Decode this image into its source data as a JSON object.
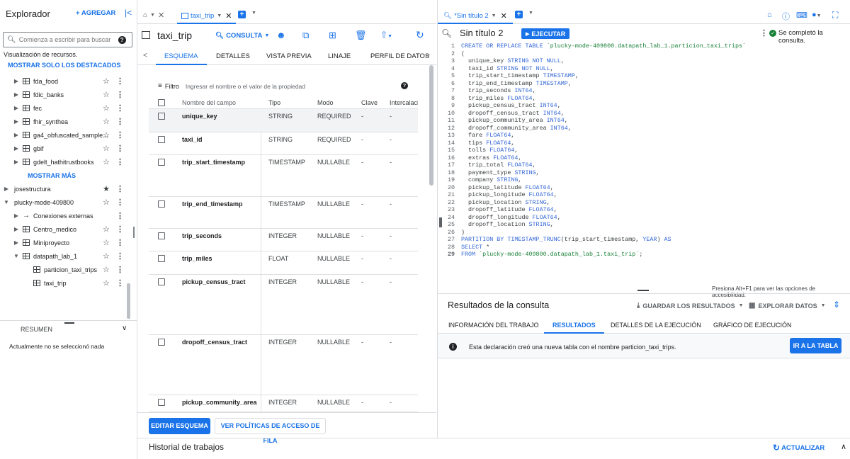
{
  "explorer": {
    "title": "Explorador",
    "add_label": "+ AGREGAR",
    "search_placeholder": "Comienza a escribir para buscar",
    "visualization": "Visualización de recursos.",
    "show_starred": "MOSTRAR SOLO LOS DESTACADOS",
    "show_more": "MOSTRAR MÁS",
    "items": [
      {
        "label": "fda_food"
      },
      {
        "label": "fdic_banks"
      },
      {
        "label": "fec"
      },
      {
        "label": "fhir_synthea"
      },
      {
        "label": "ga4_obfuscated_sample..."
      },
      {
        "label": "gbif"
      },
      {
        "label": "gdelt_hathitrustbooks"
      }
    ],
    "projects": [
      {
        "label": "josestructura"
      },
      {
        "label": "plucky-mode-409800"
      }
    ],
    "sub_items": [
      {
        "label": "Conexiones externas"
      },
      {
        "label": "Centro_medico"
      },
      {
        "label": "Miniproyecto"
      },
      {
        "label": "datapath_lab_1"
      }
    ],
    "tables": [
      {
        "label": "particion_taxi_trips"
      },
      {
        "label": "taxi_trip"
      }
    ],
    "summary_label": "RESUMEN",
    "summary_text": "Actualmente no se seleccionó nada"
  },
  "mid": {
    "tab_label": "taxi_trip",
    "title": "taxi_trip",
    "query_label": "CONSULTA",
    "tabs": [
      "ESQUEMA",
      "DETALLES",
      "VISTA PREVIA",
      "LINAJE",
      "PERFIL DE DATOS"
    ],
    "filter_label": "Filtro",
    "filter_placeholder": "Ingresar el nombre o el valor de la propiedad",
    "headers": [
      "Nombre del campo",
      "Tipo",
      "Modo",
      "Clave",
      "Intercalación"
    ],
    "rows": [
      {
        "name": "unique_key",
        "type": "STRING",
        "mode": "REQUIRED",
        "key": "-",
        "coll": "-"
      },
      {
        "name": "taxi_id",
        "type": "STRING",
        "mode": "REQUIRED",
        "key": "-",
        "coll": "-"
      },
      {
        "name": "trip_start_timestamp",
        "type": "TIMESTAMP",
        "mode": "NULLABLE",
        "key": "-",
        "coll": "-"
      },
      {
        "name": "trip_end_timestamp",
        "type": "TIMESTAMP",
        "mode": "NULLABLE",
        "key": "-",
        "coll": "-"
      },
      {
        "name": "trip_seconds",
        "type": "INTEGER",
        "mode": "NULLABLE",
        "key": "-",
        "coll": "-"
      },
      {
        "name": "trip_miles",
        "type": "FLOAT",
        "mode": "NULLABLE",
        "key": "-",
        "coll": "-"
      },
      {
        "name": "pickup_census_tract",
        "type": "INTEGER",
        "mode": "NULLABLE",
        "key": "-",
        "coll": "-"
      },
      {
        "name": "dropoff_census_tract",
        "type": "INTEGER",
        "mode": "NULLABLE",
        "key": "-",
        "coll": "-"
      },
      {
        "name": "pickup_community_area",
        "type": "INTEGER",
        "mode": "NULLABLE",
        "key": "-",
        "coll": "-"
      }
    ],
    "edit_schema": "EDITAR ESQUEMA",
    "row_policy": "VER POLÍTICAS DE ACCESO DE FILA",
    "history": "Historial de trabajos",
    "refresh": "ACTUALIZAR"
  },
  "right": {
    "tab_label": "*Sin título 2",
    "title": "Sin título 2",
    "run_label": "EJECUTAR",
    "status": "Se completó la consulta.",
    "code_lines": [
      [
        "kw:CREATE OR REPLACE TABLE ",
        "str:`plucky-mode-409800.datapath_lab_1.particion_taxi_trips`"
      ],
      [
        "t:("
      ],
      [
        "t:  unique_key ",
        "kw:STRING NOT NULL",
        "t:,"
      ],
      [
        "t:  taxi_id ",
        "kw:STRING NOT NULL",
        "t:,"
      ],
      [
        "t:  trip_start_timestamp ",
        "kw:TIMESTAMP",
        "t:,"
      ],
      [
        "t:  trip_end_timestamp ",
        "kw:TIMESTAMP",
        "t:,"
      ],
      [
        "t:  trip_seconds ",
        "kw:INT64",
        "t:,"
      ],
      [
        "t:  trip_miles ",
        "kw:FLOAT64",
        "t:,"
      ],
      [
        "t:  pickup_census_tract ",
        "kw:INT64",
        "t:,"
      ],
      [
        "t:  dropoff_census_tract ",
        "kw:INT64",
        "t:,"
      ],
      [
        "t:  pickup_community_area ",
        "kw:INT64",
        "t:,"
      ],
      [
        "t:  dropoff_community_area ",
        "kw:INT64",
        "t:,"
      ],
      [
        "t:  fare ",
        "kw:FLOAT64",
        "t:,"
      ],
      [
        "t:  tips ",
        "kw:FLOAT64",
        "t:,"
      ],
      [
        "t:  tolls ",
        "kw:FLOAT64",
        "t:,"
      ],
      [
        "t:  extras ",
        "kw:FLOAT64",
        "t:,"
      ],
      [
        "t:  trip_total ",
        "kw:FLOAT64",
        "t:,"
      ],
      [
        "t:  payment_type ",
        "kw:STRING",
        "t:,"
      ],
      [
        "t:  company ",
        "kw:STRING",
        "t:,"
      ],
      [
        "t:  pickup_latitude ",
        "kw:FLOAT64",
        "t:,"
      ],
      [
        "t:  pickup_longitude ",
        "kw:FLOAT64",
        "t:,"
      ],
      [
        "t:  pickup_location ",
        "kw:STRING",
        "t:,"
      ],
      [
        "t:  dropoff_latitude ",
        "kw:FLOAT64",
        "t:,"
      ],
      [
        "t:  dropoff_longitude ",
        "kw:FLOAT64",
        "t:,"
      ],
      [
        "t:  dropoff_location ",
        "kw:STRING",
        "t:,"
      ],
      [
        "t:)"
      ],
      [
        "kw:PARTITION BY TIMESTAMP_TRUNC",
        "t:(trip_start_timestamp, ",
        "kw:YEAR",
        "t:) ",
        "kw:AS"
      ],
      [
        "kw:SELECT ",
        "t:*"
      ],
      [
        "kw:FROM ",
        "str:`plucky-mode-409800.datapath_lab_1.taxi_trip`",
        "t:;"
      ]
    ],
    "accessibility": "Presiona Alt+F1 para ver las opciones de accesibilidad.",
    "results_title": "Resultados de la consulta",
    "save_results": "GUARDAR LOS RESULTADOS",
    "explore_data": "EXPLORAR DATOS",
    "result_tabs": [
      "INFORMACIÓN DEL TRABAJO",
      "RESULTADOS",
      "DETALLES DE LA EJECUCIÓN",
      "GRÁFICO DE EJECUCIÓN"
    ],
    "info_msg": "Esta declaración creó una nueva tabla con el nombre particion_taxi_trips.",
    "go_table": "IR A LA TABLA"
  }
}
